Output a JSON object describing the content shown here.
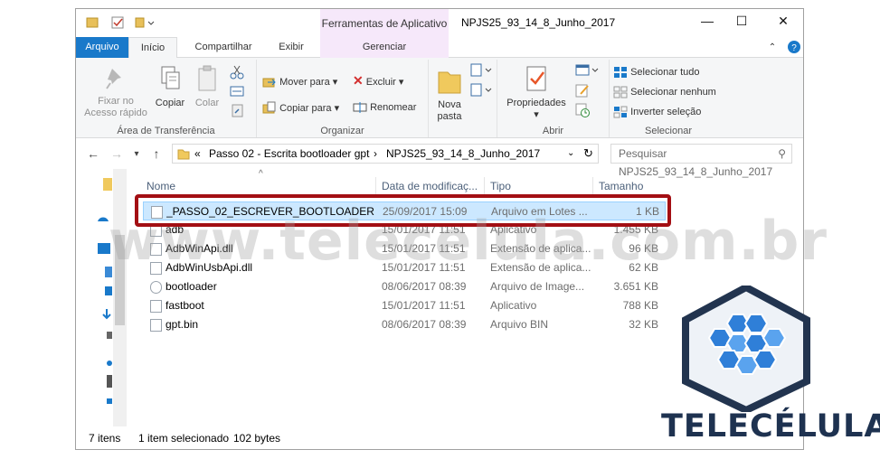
{
  "titlebar": {
    "tools_tab": "Ferramentas de Aplicativo",
    "title": "NPJS25_93_14_8_Junho_2017",
    "minimize": "—",
    "maximize": "☐",
    "close": "✕"
  },
  "tabs": {
    "file": "Arquivo",
    "home": "Início",
    "share": "Compartilhar",
    "view": "Exibir",
    "manage": "Gerenciar"
  },
  "ribbon": {
    "pin_line1": "Fixar no",
    "pin_line2": "Acesso rápido",
    "copy": "Copiar",
    "paste": "Colar",
    "group_clipboard": "Área de Transferência",
    "move_to": "Mover para",
    "copy_to": "Copiar para",
    "delete": "Excluir",
    "rename": "Renomear",
    "group_organize": "Organizar",
    "new_folder_line1": "Nova",
    "new_folder_line2": "pasta",
    "properties": "Propriedades",
    "group_open": "Abrir",
    "select_all": "Selecionar tudo",
    "select_none": "Selecionar nenhum",
    "invert_selection": "Inverter seleção",
    "group_select": "Selecionar"
  },
  "address": {
    "prefix": "«",
    "crumb1": "Passo 02 - Escrita bootloader gpt",
    "sep": "›",
    "crumb2": "NPJS25_93_14_8_Junho_2017",
    "search_placeholder": "Pesquisar NPJS25_93_14_8_Junho_2017"
  },
  "columns": {
    "name": "Nome",
    "date": "Data de modificaç...",
    "type": "Tipo",
    "size": "Tamanho"
  },
  "files": [
    {
      "name": "_PASSO_02_ESCREVER_BOOTLOADER",
      "date": "25/09/2017 15:09",
      "type": "Arquivo em Lotes ...",
      "size": "1 KB"
    },
    {
      "name": "adb",
      "date": "15/01/2017 11:51",
      "type": "Aplicativo",
      "size": "1.455 KB"
    },
    {
      "name": "AdbWinApi.dll",
      "date": "15/01/2017 11:51",
      "type": "Extensão de aplica...",
      "size": "96 KB"
    },
    {
      "name": "AdbWinUsbApi.dll",
      "date": "15/01/2017 11:51",
      "type": "Extensão de aplica...",
      "size": "62 KB"
    },
    {
      "name": "bootloader",
      "date": "08/06/2017 08:39",
      "type": "Arquivo de Image...",
      "size": "3.651 KB"
    },
    {
      "name": "fastboot",
      "date": "15/01/2017 11:51",
      "type": "Aplicativo",
      "size": "788 KB"
    },
    {
      "name": "gpt.bin",
      "date": "08/06/2017 08:39",
      "type": "Arquivo BIN",
      "size": "32 KB"
    }
  ],
  "status": {
    "items": "7 itens",
    "selected": "1 item selecionado",
    "size": "102 bytes"
  },
  "watermark": "www.telecelula.com.br",
  "brand": "TELECÉLULA",
  "colors": {
    "accent": "#1979ca",
    "selection": "#cce8ff",
    "highlight_border": "#a30f14",
    "brand_blue": "#1e3250"
  }
}
